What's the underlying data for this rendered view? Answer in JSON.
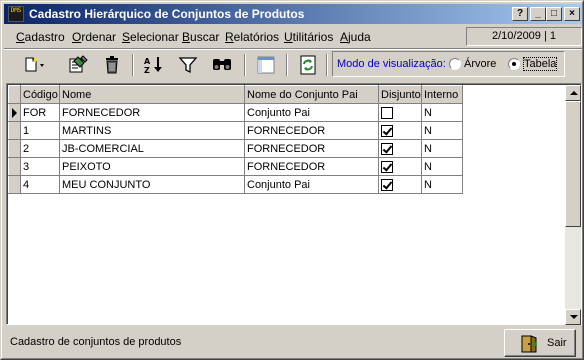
{
  "window": {
    "title": "Cadastro Hierárquico de Conjuntos de Produtos",
    "app_icon_text": "DMS"
  },
  "title_buttons": {
    "help": "?",
    "minimize": "_",
    "maximize": "□",
    "close": "×"
  },
  "menu": {
    "items": [
      "Cadastro",
      "Ordenar",
      "Selecionar",
      "Buscar",
      "Relatórios",
      "Utilitários",
      "Ajuda"
    ],
    "date_info": "2/10/2009 | 1"
  },
  "toolbar": {
    "icons": [
      "new-icon",
      "edit-icon",
      "delete-icon",
      "sort-icon",
      "filter-icon",
      "find-icon",
      "layout-icon",
      "refresh-icon"
    ],
    "mode_label": "Modo de visualização:",
    "radio_tree": "Árvore",
    "radio_table": "Tabela",
    "selected_mode": "Tabela"
  },
  "grid": {
    "columns": [
      "Código",
      "Nome",
      "Nome do Conjunto Pai",
      "Disjunto",
      "Interno"
    ],
    "rows": [
      {
        "codigo": "FOR",
        "nome": "FORNECEDOR",
        "pai": "Conjunto Pai",
        "disjunto": false,
        "interno": "N",
        "current": true
      },
      {
        "codigo": "1",
        "nome": "MARTINS",
        "pai": "FORNECEDOR",
        "disjunto": true,
        "interno": "N",
        "current": false
      },
      {
        "codigo": "2",
        "nome": "JB-COMERCIAL",
        "pai": "FORNECEDOR",
        "disjunto": true,
        "interno": "N",
        "current": false
      },
      {
        "codigo": "3",
        "nome": "PEIXOTO",
        "pai": "FORNECEDOR",
        "disjunto": true,
        "interno": "N",
        "current": false
      },
      {
        "codigo": "4",
        "nome": "MEU CONJUNTO",
        "pai": "Conjunto Pai",
        "disjunto": true,
        "interno": "N",
        "current": false
      }
    ]
  },
  "status": {
    "text": "Cadastro de conjuntos de produtos",
    "exit_label": "Sair"
  },
  "colors": {
    "title_start": "#0a246a",
    "title_end": "#a6caf0",
    "face": "#d4d0c8",
    "mode_label": "#0000c0"
  }
}
